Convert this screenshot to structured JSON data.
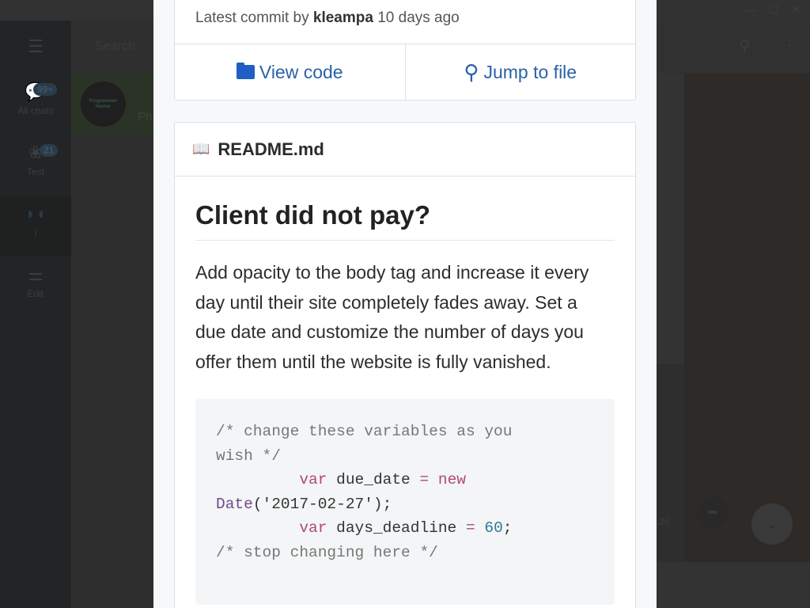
{
  "app": {
    "search_placeholder": "Search",
    "chat_name": "Ph",
    "avatar_text": "Programmer Humor",
    "time": ":26",
    "sidebar": [
      {
        "label": "All chats",
        "badge": "99+",
        "icon": "chat-bubbles-icon"
      },
      {
        "label": "Test",
        "badge": "21",
        "icon": "flower-icon"
      },
      {
        "label": "i",
        "icon": "mask-icon"
      },
      {
        "label": "Edit",
        "icon": "sliders-icon"
      }
    ]
  },
  "viewer": {
    "commit": {
      "prefix": "Latest commit by",
      "author": "kleampa",
      "suffix": "10 days ago"
    },
    "view_code": "View code",
    "jump_to_file": "Jump to file",
    "readme_title": "README.md",
    "heading": "Client did not pay?",
    "paragraph": "Add opacity to the body tag and increase it every day until their site completely fades away. Set a due date and customize the number of days you offer them until the website is fully vanished.",
    "code": {
      "c1": "/* change these variables as you",
      "c1b": "wish */",
      "var1": "var",
      "due": " due_date ",
      "eq": "=",
      "new": " new",
      "date_fn": "Date",
      "date_arg": "('2017-02-27');",
      "var2": "var",
      "days": " days_deadline ",
      "num": "60",
      "semi": ";",
      "c2": "/* stop changing here */"
    },
    "colors": {
      "link": "#2a62a8",
      "folder": "#1f5ec4",
      "keyword": "#b04a74",
      "number": "#2f7a96"
    }
  }
}
